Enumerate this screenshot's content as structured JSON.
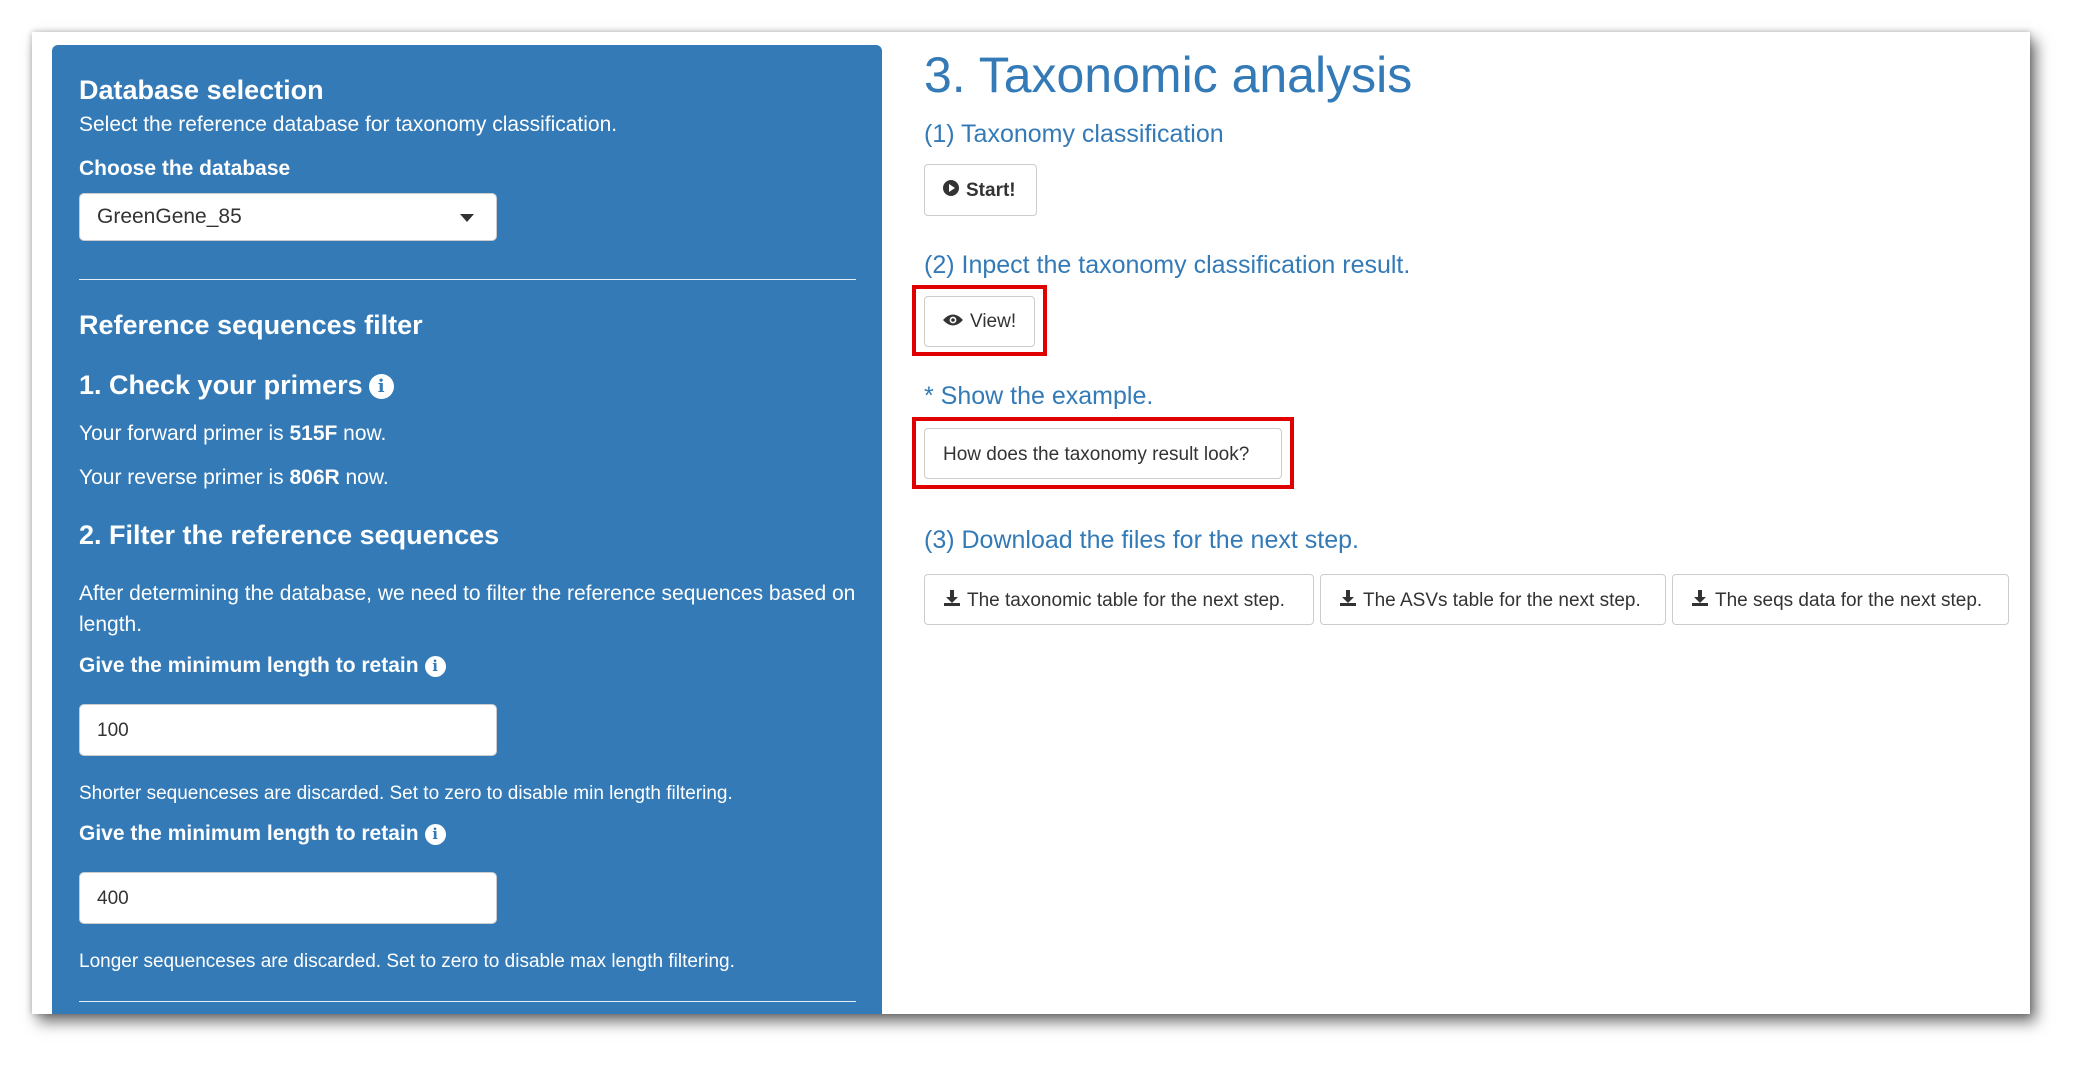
{
  "sidebar": {
    "db_heading": "Database selection",
    "db_subtitle": "Select the reference database for taxonomy classification.",
    "db_label": "Choose the database",
    "db_selected": "GreenGene_85",
    "ref_heading": "Reference sequences filter",
    "step1_heading": "1. Check your primers",
    "forward_prefix": "Your forward primer is ",
    "forward_primer": "515F",
    "forward_suffix": " now.",
    "reverse_prefix": "Your reverse primer is ",
    "reverse_primer": "806R",
    "reverse_suffix": " now.",
    "step2_heading": "2. Filter the reference sequences",
    "step2_desc": "After determining the database, we need to filter the reference sequences based on length.",
    "min_label": "Give the minimum length to retain",
    "min_value": "100",
    "min_help": "Shorter sequenceses are discarded. Set to zero to disable min length filtering.",
    "max_label": "Give the minimum length to retain",
    "max_value": "400",
    "max_help": "Longer sequenceses are discarded. Set to zero to disable max length filtering."
  },
  "main": {
    "title": "3. Taxonomic analysis",
    "sec1": "(1) Taxonomy classification",
    "start_label": "Start!",
    "sec2": "(2) Inpect the taxonomy classification result.",
    "view_label": "View!",
    "sec_example": "* Show the example.",
    "example_label": "How does the taxonomy result look?",
    "sec3": "(3) Download the files for the next step.",
    "downloads": [
      "The taxonomic table for the next step.",
      "The ASVs table for the next step.",
      "The seqs data for the next step."
    ]
  },
  "colors": {
    "sidebar_bg": "#337ab7",
    "heading": "#337ab7",
    "highlight": "#e00000"
  },
  "icons": {
    "start": "play-circle-icon",
    "view": "eye-icon",
    "download": "download-icon",
    "info": "info-circle-icon",
    "dropdown": "caret-down-icon"
  }
}
